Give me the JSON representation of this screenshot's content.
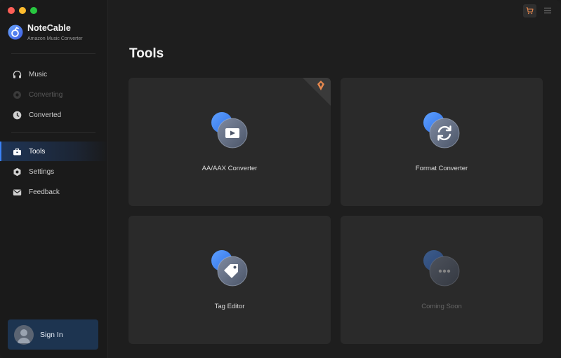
{
  "app": {
    "name": "NoteCable",
    "subtitle": "Amazon Music Converter"
  },
  "sidebar": {
    "items": [
      {
        "label": "Music",
        "icon": "headphones-icon",
        "state": "normal"
      },
      {
        "label": "Converting",
        "icon": "converting-icon",
        "state": "disabled"
      },
      {
        "label": "Converted",
        "icon": "clock-icon",
        "state": "normal"
      },
      {
        "label": "Tools",
        "icon": "toolbox-icon",
        "state": "active"
      },
      {
        "label": "Settings",
        "icon": "gear-icon",
        "state": "normal"
      },
      {
        "label": "Feedback",
        "icon": "mail-icon",
        "state": "normal"
      }
    ],
    "signin_label": "Sign In"
  },
  "main": {
    "title": "Tools",
    "cards": [
      {
        "label": "AA/AAX Converter",
        "icon": "audiobook-play-icon",
        "premium": true
      },
      {
        "label": "Format Converter",
        "icon": "refresh-icon",
        "premium": false
      },
      {
        "label": "Tag Editor",
        "icon": "tag-icon",
        "premium": false
      },
      {
        "label": "Coming Soon",
        "icon": "more-dots-icon",
        "premium": false,
        "disabled": true
      }
    ]
  },
  "colors": {
    "accent": "#3b82f6",
    "background": "#1e1e1e",
    "sidebar": "#1a1a1a",
    "card": "#2a2a2a",
    "premium_badge": "#e8894f"
  }
}
